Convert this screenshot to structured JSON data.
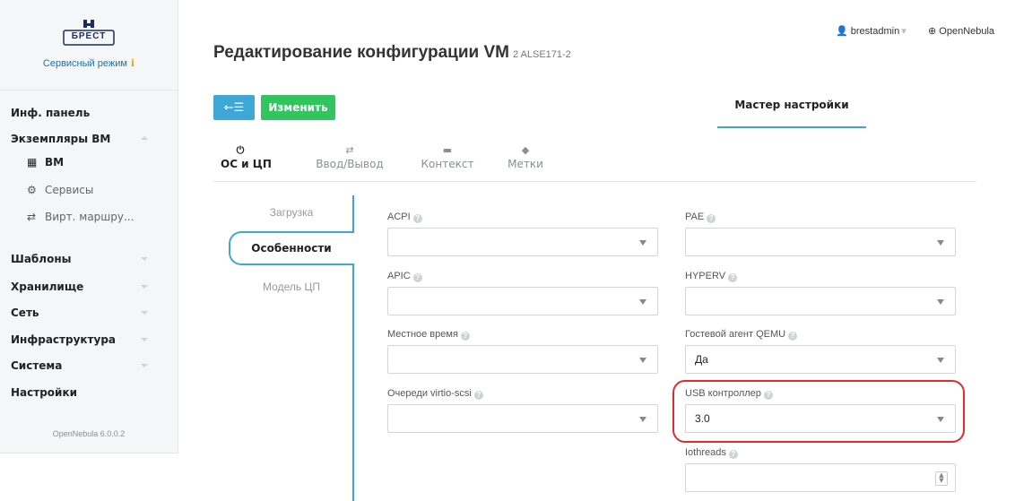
{
  "app": {
    "logo_text": "БРЕСТ",
    "service_mode": "Сервисный режим",
    "service_mode_icon": "info-icon",
    "version": "OpenNebula 6.0.0.2"
  },
  "sidebar": {
    "items": [
      {
        "label": "Инф. панель"
      },
      {
        "label": "Экземпляры ВМ",
        "expanded": true,
        "children": [
          {
            "label": "ВМ",
            "icon": "grid-icon",
            "active": true
          },
          {
            "label": "Сервисы",
            "icon": "services-icon"
          },
          {
            "label": "Вирт. маршру...",
            "icon": "router-icon"
          }
        ]
      },
      {
        "label": "Шаблоны"
      },
      {
        "label": "Хранилище"
      },
      {
        "label": "Сеть"
      },
      {
        "label": "Инфраструктура"
      },
      {
        "label": "Система"
      },
      {
        "label": "Настройки"
      }
    ]
  },
  "header": {
    "title": "Редактирование конфигурации VM",
    "subtitle": "2 ALSE171-2",
    "user": "brestadmin",
    "zone": "OpenNebula"
  },
  "toolbar": {
    "back_icon": "back-list-icon",
    "update_label": "Изменить",
    "wizard_label": "Мастер настройки"
  },
  "tabs": [
    {
      "label": "ОС и ЦП",
      "icon": "power-icon",
      "active": true
    },
    {
      "label": "Ввод/Вывод",
      "icon": "exchange-icon"
    },
    {
      "label": "Контекст",
      "icon": "folder-icon"
    },
    {
      "label": "Метки",
      "icon": "tag-icon"
    }
  ],
  "subtabs": [
    {
      "label": "Загрузка"
    },
    {
      "label": "Особенности",
      "active": true
    },
    {
      "label": "Модель ЦП"
    }
  ],
  "fields": {
    "acpi": {
      "label": "ACPI",
      "value": ""
    },
    "pae": {
      "label": "PAE",
      "value": ""
    },
    "apic": {
      "label": "APIC",
      "value": ""
    },
    "hyperv": {
      "label": "HYPERV",
      "value": ""
    },
    "localtime": {
      "label": "Местное время",
      "value": ""
    },
    "guest_agent": {
      "label": "Гостевой агент QEMU",
      "value": "Да"
    },
    "virtio_queues": {
      "label": "Очереди virtio-scsi",
      "value": ""
    },
    "usb_controller": {
      "label": "USB контроллер",
      "value": "3.0"
    },
    "iothreads": {
      "label": "Iothreads",
      "value": ""
    }
  },
  "colors": {
    "accent": "#3fa7d6",
    "update_button": "#32c45e",
    "highlight": "#e32b2b"
  }
}
